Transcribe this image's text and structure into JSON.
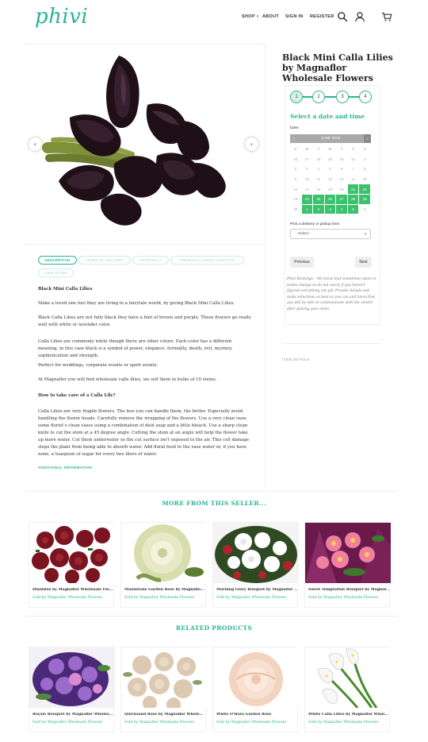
{
  "header": {
    "logo": "phivi",
    "nav": {
      "shop": "SHOP",
      "about": "ABOUT",
      "sign_in": "SIGN IN",
      "register": "REGISTER"
    },
    "icons": [
      "search-icon",
      "user-icon",
      "cart-icon"
    ]
  },
  "gallery": {
    "prev_icon": "‹",
    "next_icon": "›"
  },
  "tabs": [
    {
      "label": "DESCRIPTION",
      "active": true
    },
    {
      "label": "TERMS OF DELIVERY",
      "active": false
    },
    {
      "label": "REFERRALS",
      "active": false
    },
    {
      "label": "PREMIUM FLOWER VARIETIES",
      "active": false
    },
    {
      "label": "VIEW STORE",
      "active": false
    }
  ],
  "description": {
    "heading": "Black Mini Calla Lilies",
    "p1": "Make a loved one feel they are living in a fairytale world, by giving Black Mini Calla Lilies.",
    "p2": "Black Calla Lilies are not fully black they have a hint of brown and purple. These flowers go really well with white or lavender color.",
    "p3": "Calla Lilies are commonly white though there are other colors. Each color has a different meaning, in this case black is a symbol of power, elegance, formality, death, evil, mystery, sophistication and strength.",
    "p4": "Perfect for weddings, corporate events or sport events.",
    "p5": "At Magnaflor you will find wholesale calle lilies, we sell them in bulks of 10 stems.",
    "care_heading": "How to take care of a Calla Lily?",
    "p6": "Calla Lilies are very fragile flowers. The less you can handle them, the better. Especially avoid handling the flower heads. Carefully remove the wrapping of the flowers. Use a very clean vase; some florist's clean vases using a combination of dish soap and a little bleach. Use a sharp clean knife to cut the stem at a 45 degree angle. Cutting the stem at an angle will help the flower take up more water. Cut them underwater so the cut surface isn't exposed to the air. This cell damage stops the plant from being able to absorb water. Add floral food to the vase water or, if you have none, a teaspoon of sugar for every two liters of water.",
    "additional_info": "ADDITIONAL INFORMATION"
  },
  "product": {
    "title": "Black Mini Calla Lilies by Magnaflor Wholesale Flowers",
    "steps": [
      "1",
      "2",
      "3",
      "4"
    ],
    "select_heading": "Select a date and time",
    "date_label": "Date:",
    "calendar": {
      "month": "JUNE 2019",
      "prev": "‹",
      "next": "›",
      "dow": [
        "S",
        "M",
        "T",
        "W",
        "T",
        "F",
        "S"
      ],
      "weeks": [
        [
          "26",
          "27",
          "28",
          "29",
          "30",
          "31",
          "1"
        ],
        [
          "2",
          "3",
          "4",
          "5",
          "6",
          "7",
          "8"
        ],
        [
          "9",
          "10",
          "11",
          "12",
          "13",
          "14",
          "15"
        ],
        [
          "16",
          "17",
          "18",
          "19",
          "20",
          "21",
          "22"
        ],
        [
          "23",
          "24",
          "25",
          "26",
          "27",
          "28",
          "29"
        ],
        [
          "30",
          "1",
          "2",
          "3",
          "4",
          "5",
          "6"
        ]
      ]
    },
    "time_label": "Pick a delivery or pickup time",
    "time_placeholder": "- Select -",
    "prev_button": "Previous",
    "next_button": "Next",
    "booking_note": "Phivi Bookings – We know that sometimes plans or tastes change so do not worry if you haven't figured everything out yet. Provide details and make selections as best as you can and know that you will be able to communicate with the vendor after placing your order.",
    "item_details": "ITEM DETAILS"
  },
  "more_from_seller": {
    "heading": "MORE FROM THIS SELLER...",
    "items": [
      {
        "name": "Dianthus by Magnaflor Wholesale Flo...",
        "seller": "Sold by Magnaflor Wholesale Flowers"
      },
      {
        "name": "Moonstone Garden Rose by Magnaflo...",
        "seller": "Sold by Magnaflor Wholesale Flowers"
      },
      {
        "name": "Morning Glory Bouquet by Magnaflor ...",
        "seller": "Sold by Magnaflor Wholesale Flowers"
      },
      {
        "name": "Sweet Temptation Bouquet by Magnaf...",
        "seller": "Sold by Magnaflor Wholesale Flowers"
      }
    ]
  },
  "related": {
    "heading": "RELATED PRODUCTS",
    "items": [
      {
        "name": "Royale Bouquet by Magnaflor Wholes...",
        "seller": "Sold by Magnaflor Wholesale Flowers"
      },
      {
        "name": "Quicksand Rose by Magnaflor Whole...",
        "seller": "Sold by Magnaflor Wholesale Flowers"
      },
      {
        "name": "White O'Hara Garden Rose",
        "seller": "Sold by Magnaflor Wholesale Flowers"
      },
      {
        "name": "White Calla Lilies by Magnaflor Whol...",
        "seller": "Sold by Magnaflor Wholesale Flowers"
      }
    ]
  },
  "colors": {
    "brand": "#2bb394",
    "calendar_available": "#3cc16d",
    "calendar_header": "#a9a9a9"
  }
}
